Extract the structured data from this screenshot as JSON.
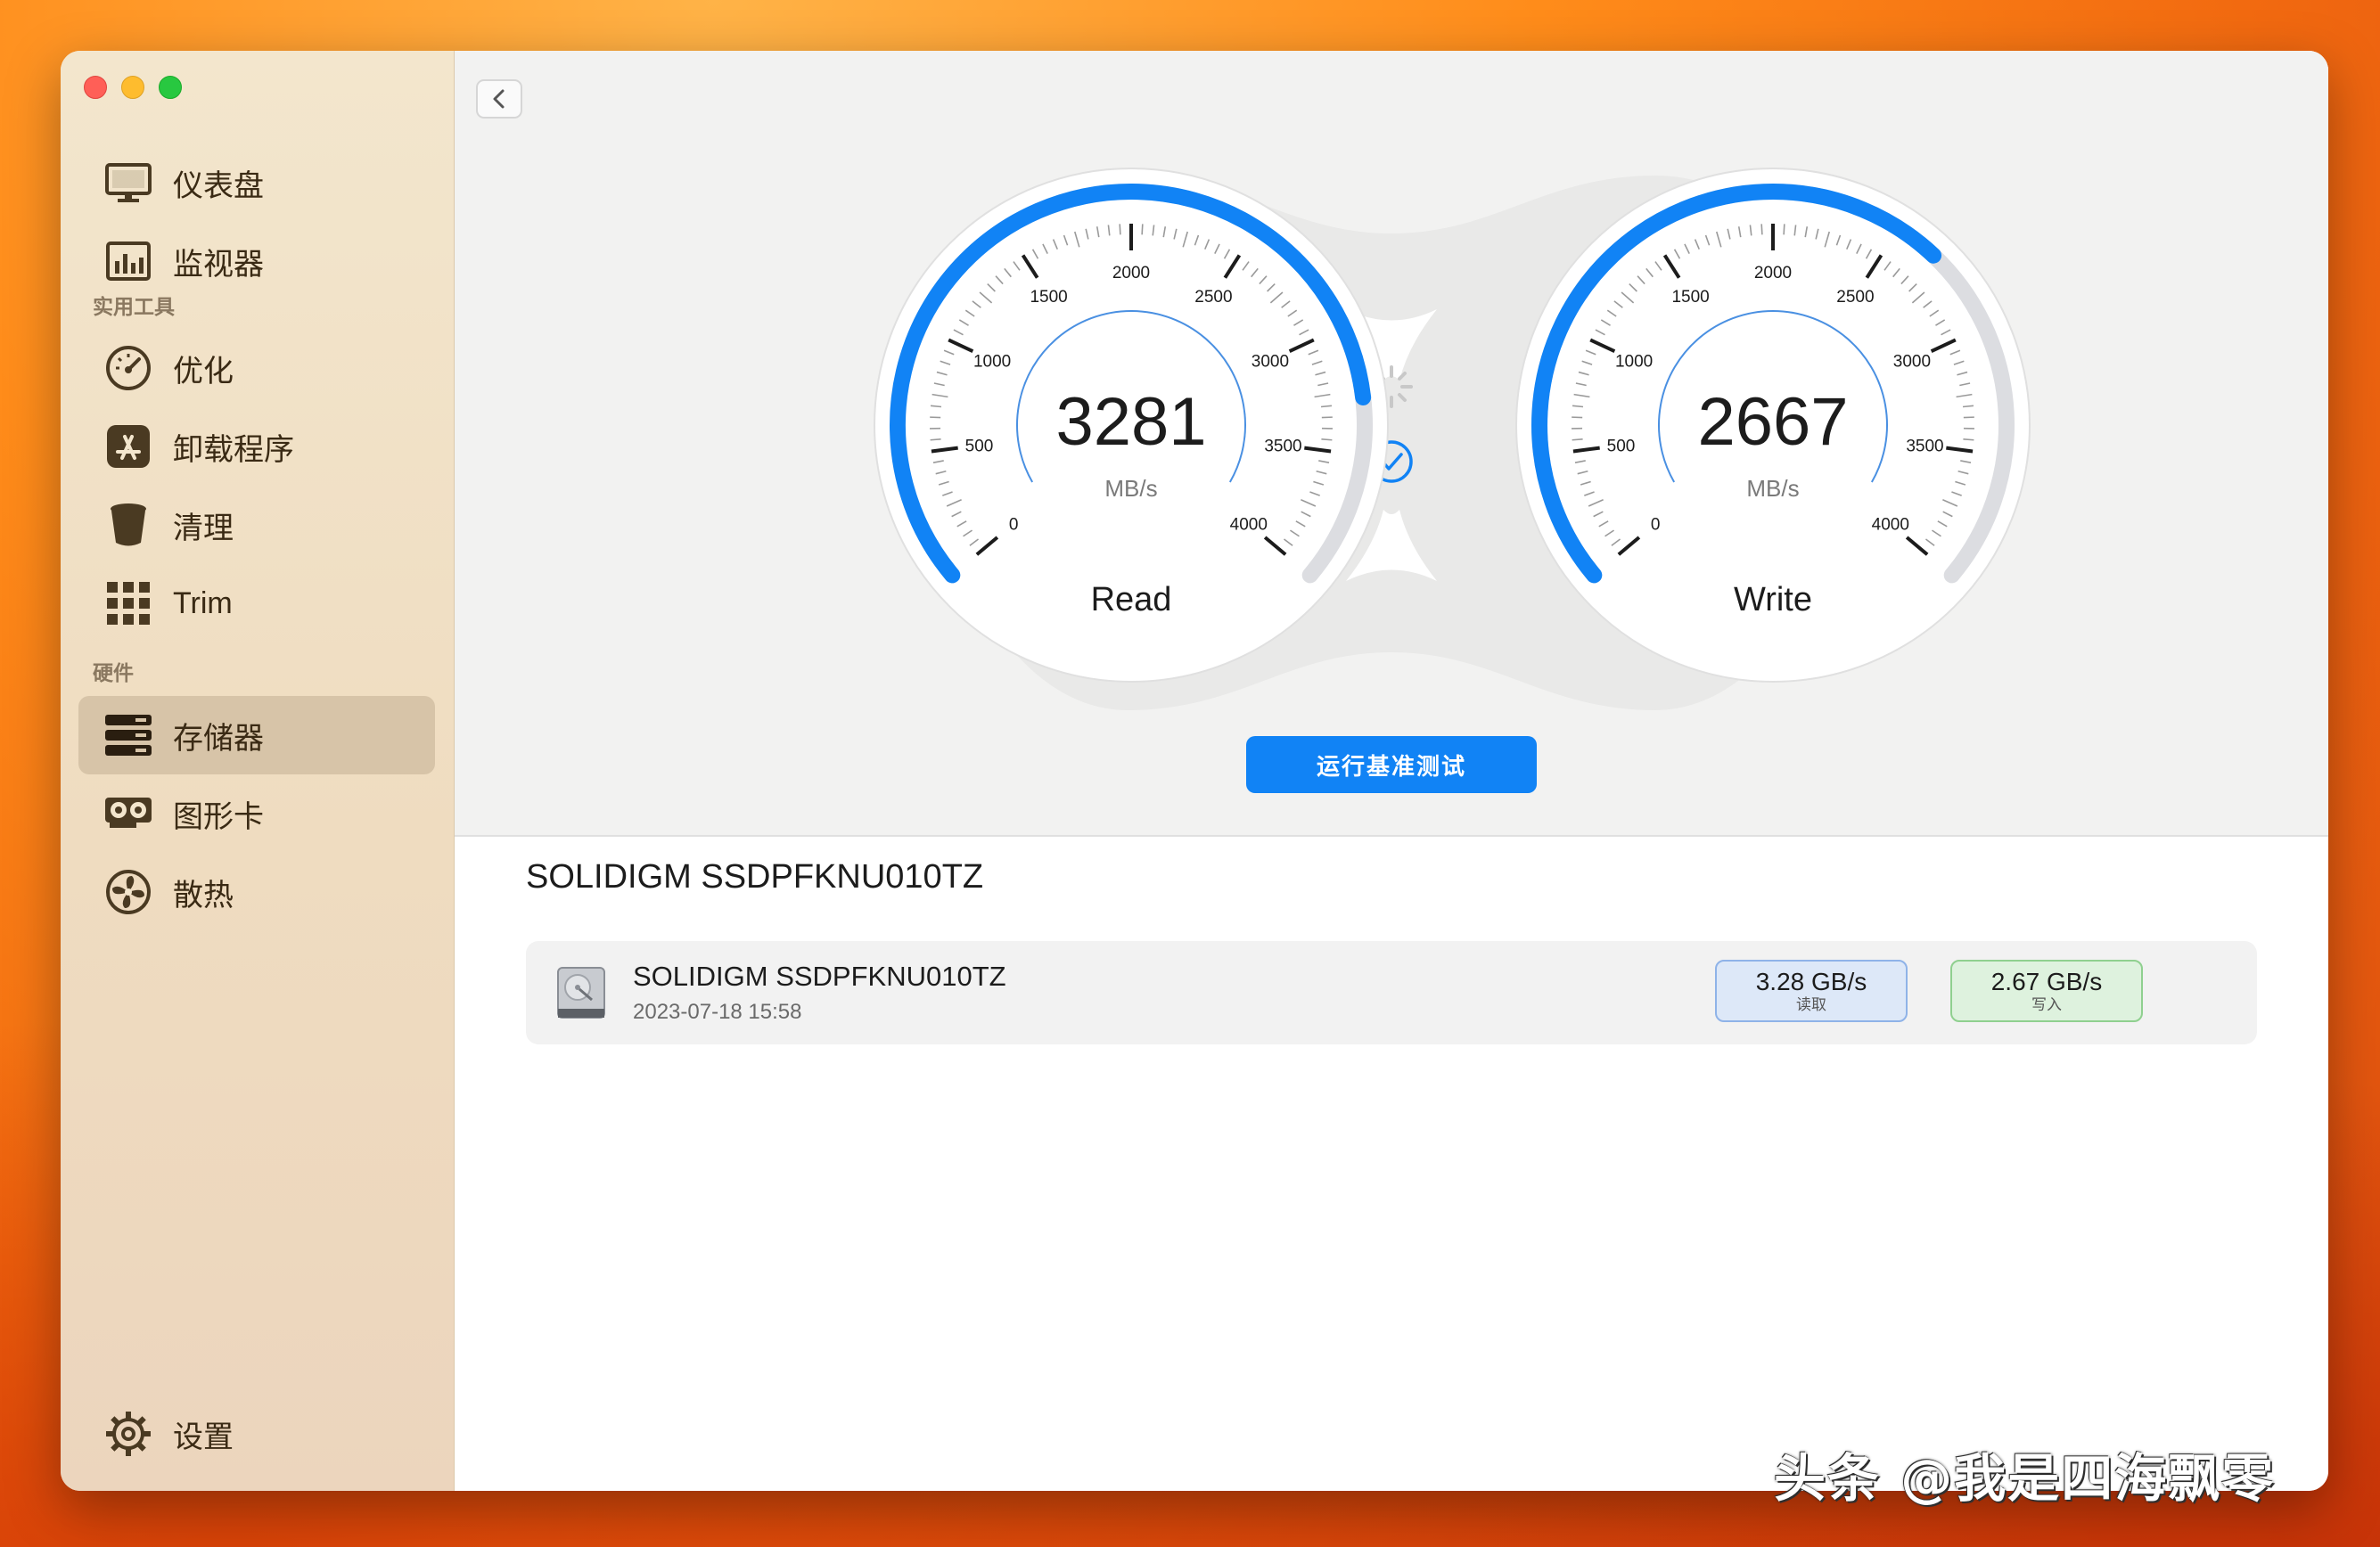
{
  "sidebar": {
    "items_top": [
      {
        "label": "仪表盘",
        "icon": "monitor-icon"
      },
      {
        "label": "监视器",
        "icon": "chart-icon"
      }
    ],
    "section_tools": "实用工具",
    "items_tools": [
      {
        "label": "优化",
        "icon": "speedometer-icon"
      },
      {
        "label": "卸载程序",
        "icon": "app-store-icon"
      },
      {
        "label": "清理",
        "icon": "trash-bin-icon"
      },
      {
        "label": "Trim",
        "icon": "grid-icon"
      }
    ],
    "section_hardware": "硬件",
    "items_hardware": [
      {
        "label": "存储器",
        "icon": "storage-icon",
        "active": true
      },
      {
        "label": "图形卡",
        "icon": "gpu-icon"
      },
      {
        "label": "散热",
        "icon": "fan-icon"
      }
    ],
    "settings_label": "设置"
  },
  "gauges": {
    "read": {
      "value": "3281",
      "unit": "MB/s",
      "label": "Read",
      "fraction": 0.82
    },
    "write": {
      "value": "2667",
      "unit": "MB/s",
      "label": "Write",
      "fraction": 0.667
    },
    "scale_max": 4000,
    "tick_labels": [
      "0",
      "500",
      "1000",
      "1500",
      "2000",
      "2500",
      "3000",
      "3500",
      "4000"
    ],
    "accent": "#1183f5"
  },
  "run_button": "运行基准测试",
  "disk": {
    "title": "SOLIDIGM SSDPFKNU010TZ",
    "result": {
      "name": "SOLIDIGM SSDPFKNU010TZ",
      "date": "2023-07-18 15:58",
      "read_value": "3.28 GB/s",
      "read_label": "读取",
      "write_value": "2.67 GB/s",
      "write_label": "写入"
    }
  },
  "watermark": "头条 @我是四海飘零"
}
